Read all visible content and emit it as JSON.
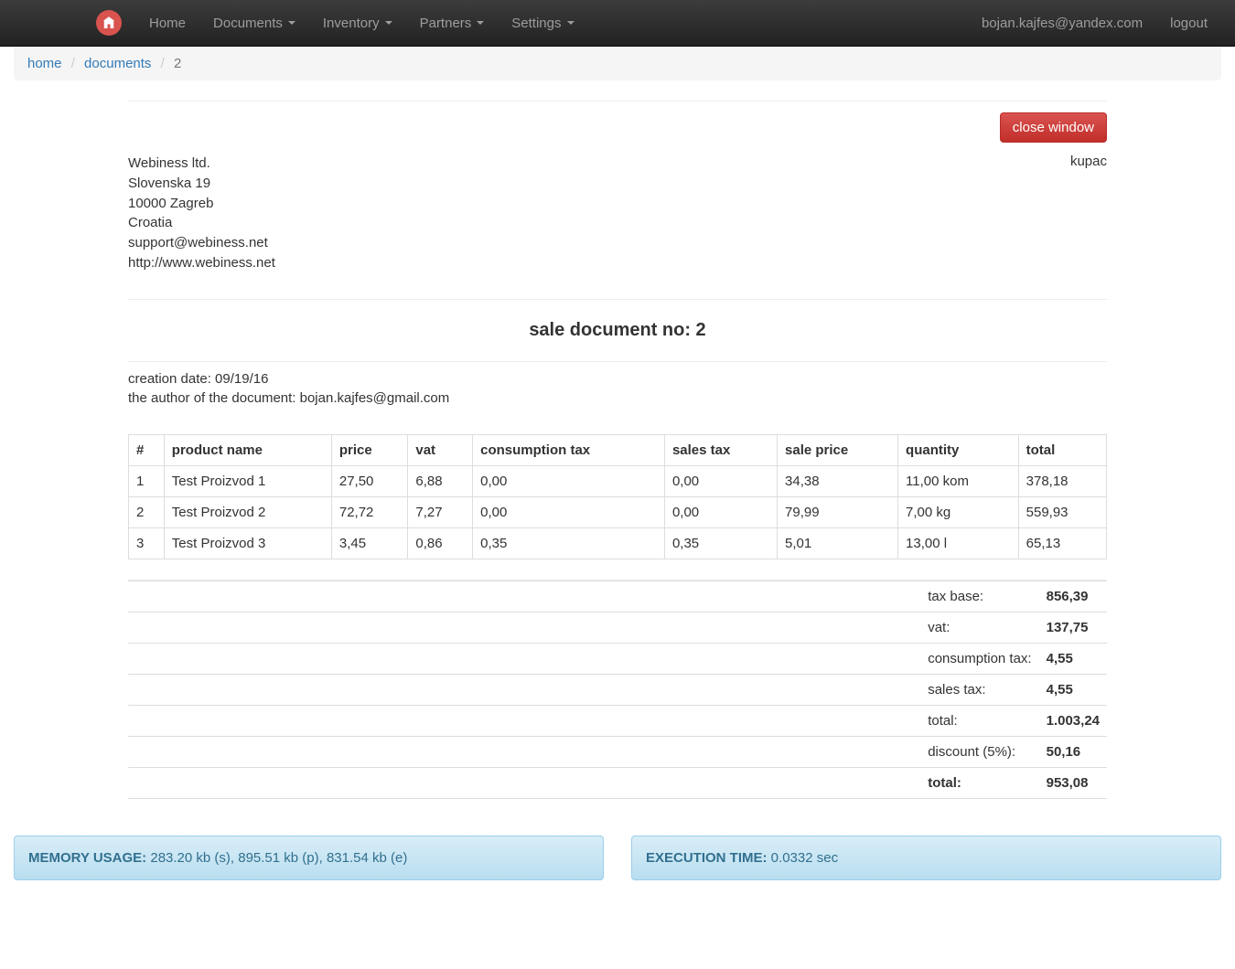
{
  "nav": {
    "home": "Home",
    "documents": "Documents",
    "inventory": "Inventory",
    "partners": "Partners",
    "settings": "Settings",
    "user_email": "bojan.kajfes@yandex.com",
    "logout": "logout"
  },
  "breadcrumb": {
    "home": "home",
    "documents": "documents",
    "current": "2"
  },
  "toolbar": {
    "close": "close window"
  },
  "company": {
    "name": "Webiness ltd.",
    "street": "Slovenska 19",
    "city": "10000 Zagreb",
    "country": "Croatia",
    "email": "support@webiness.net",
    "url": "http://www.webiness.net"
  },
  "kupac": "kupac",
  "doc_title": "sale document no: 2",
  "meta": {
    "creation": "creation date: 09/19/16",
    "author": "the author of the document: bojan.kajfes@gmail.com"
  },
  "columns": {
    "idx": "#",
    "name": "product name",
    "price": "price",
    "vat": "vat",
    "ctax": "consumption tax",
    "stax": "sales tax",
    "sale_price": "sale price",
    "qty": "quantity",
    "total": "total"
  },
  "rows": [
    {
      "idx": "1",
      "name": "Test Proizvod 1",
      "price": "27,50",
      "vat": "6,88",
      "ctax": "0,00",
      "stax": "0,00",
      "sale_price": "34,38",
      "qty": "11,00 kom",
      "total": "378,18"
    },
    {
      "idx": "2",
      "name": "Test Proizvod 2",
      "price": "72,72",
      "vat": "7,27",
      "ctax": "0,00",
      "stax": "0,00",
      "sale_price": "79,99",
      "qty": "7,00 kg",
      "total": "559,93"
    },
    {
      "idx": "3",
      "name": "Test Proizvod 3",
      "price": "3,45",
      "vat": "0,86",
      "ctax": "0,35",
      "stax": "0,35",
      "sale_price": "5,01",
      "qty": "13,00 l",
      "total": "65,13"
    }
  ],
  "summary": [
    {
      "label": "tax base:",
      "value": "856,39",
      "grand": false
    },
    {
      "label": "vat:",
      "value": "137,75",
      "grand": false
    },
    {
      "label": "consumption tax:",
      "value": "4,55",
      "grand": false
    },
    {
      "label": "sales tax:",
      "value": "4,55",
      "grand": false
    },
    {
      "label": "total:",
      "value": "1.003,24",
      "grand": false
    },
    {
      "label": "discount (5%):",
      "value": "50,16",
      "grand": false
    },
    {
      "label": "total:",
      "value": "953,08",
      "grand": true
    }
  ],
  "footer": {
    "mem_label": "MEMORY USAGE:",
    "mem_value": " 283.20 kb (s), 895.51 kb (p), 831.54 kb (e)",
    "exec_label": "EXECUTION TIME:",
    "exec_value": " 0.0332 sec"
  }
}
